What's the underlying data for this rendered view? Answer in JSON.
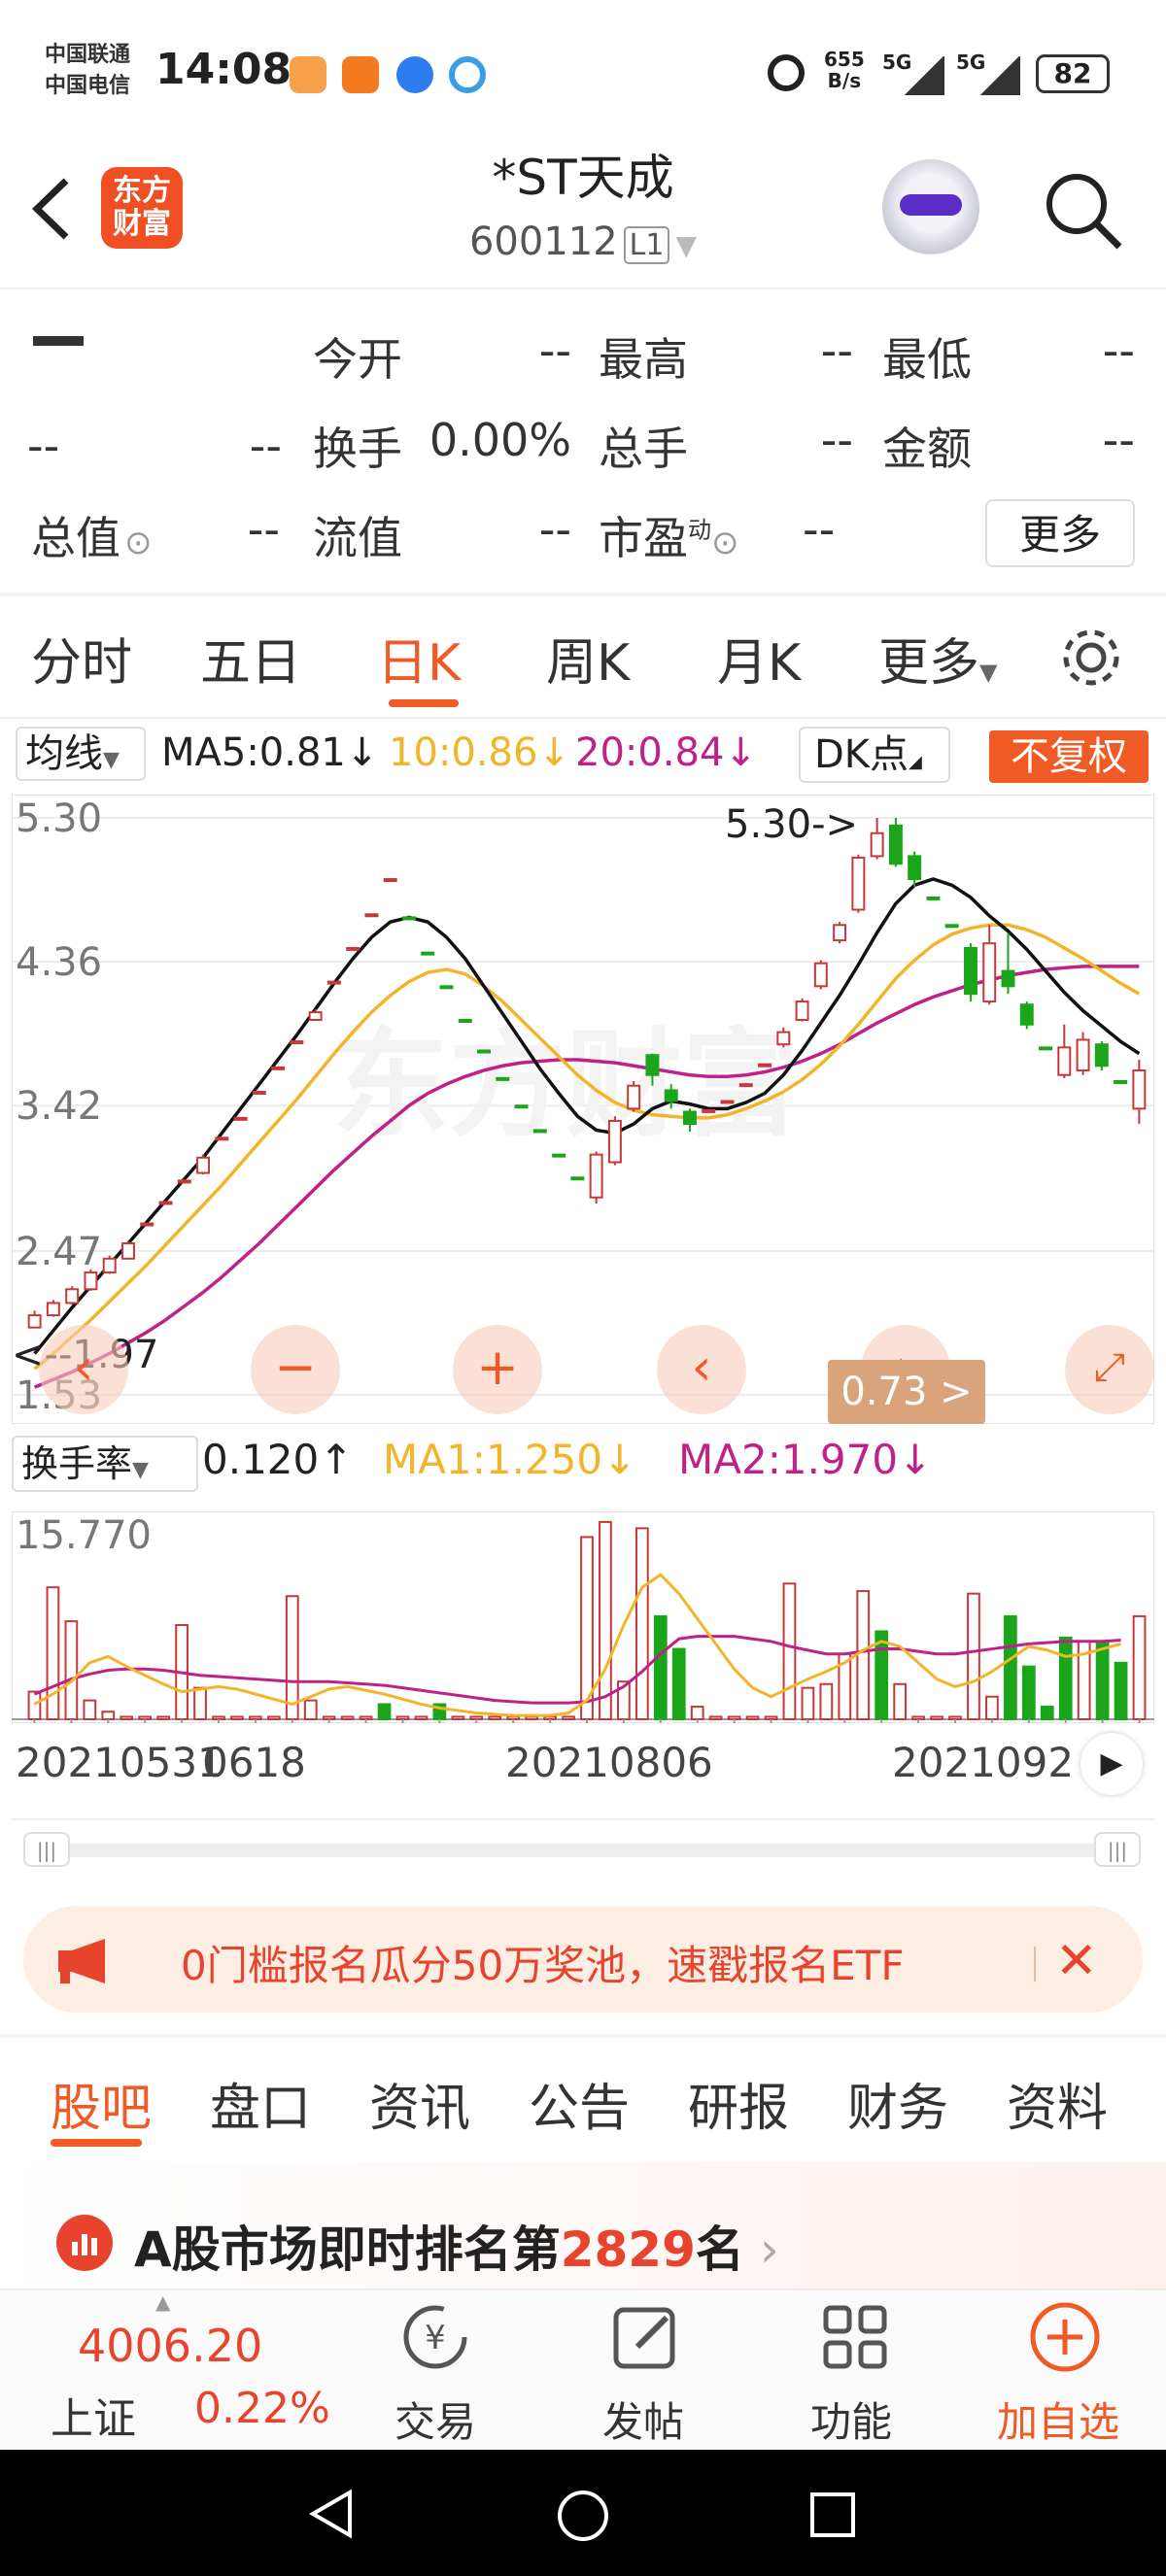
{
  "status_bar": {
    "carrier1": "中国联通",
    "carrier2": "中国电信",
    "time": "14:08",
    "net_speed_value": "655",
    "net_speed_unit": "B/s",
    "signal1": "5G",
    "signal2": "5G",
    "battery": "82"
  },
  "header": {
    "logo_text": "东方财富",
    "title": "*ST天成",
    "code": "600112",
    "level": "L1"
  },
  "quote": {
    "price": "--",
    "change": "--",
    "change_pct": "--",
    "open_label": "今开",
    "open_value": "--",
    "high_label": "最高",
    "high_value": "--",
    "low_label": "最低",
    "low_value": "--",
    "turnover_label": "换手",
    "turnover_value": "0.00%",
    "volume_label": "总手",
    "volume_value": "--",
    "amount_label": "金额",
    "amount_value": "--",
    "mktcap_label": "总值",
    "mktcap_value": "--",
    "float_label": "流值",
    "float_value": "--",
    "pe_label": "市盈",
    "pe_sup": "动",
    "pe_value": "--",
    "more_label": "更多"
  },
  "period_tabs": [
    "分时",
    "五日",
    "日K",
    "周K",
    "月K",
    "更多"
  ],
  "ma_bar": {
    "select": "均线",
    "ma5": "MA5:0.81",
    "ma10": "10:0.86",
    "ma20": "20:0.84",
    "dk": "DK点",
    "adjust": "不复权"
  },
  "chart_labels": {
    "high_marker": "5.30->",
    "low_marker": "<--1.97",
    "tooltip": "0.73 >"
  },
  "turnover_bar": {
    "select": "换手率",
    "value": "0.120",
    "ma1": "MA1:1.250",
    "ma2": "MA2:1.970",
    "max_label": "15.770"
  },
  "dates": [
    "20210531",
    "0618",
    "20210806",
    "2021092"
  ],
  "promo": {
    "text": "0门槛报名瓜分50万奖池，速戳报名ETF"
  },
  "bottom_tabs": [
    "股吧",
    "盘口",
    "资讯",
    "公告",
    "研报",
    "财务",
    "资料"
  ],
  "rank": {
    "prefix": "A股市场即时排名第",
    "number": "2829",
    "suffix": "名"
  },
  "bottom_bar": {
    "index_value": "4006.20",
    "index_name": "上证",
    "index_pct": "0.22%",
    "trade": "交易",
    "post": "发帖",
    "functions": "功能",
    "add_watch": "加自选"
  },
  "colors": {
    "accent": "#f05a24",
    "up": "#c8383a",
    "down": "#1aa51a",
    "ma5": "#111111",
    "ma10": "#f2b52a",
    "ma20": "#c0208a"
  },
  "chart_data": {
    "type": "candlestick",
    "y_ticks": [
      "5.30",
      "4.36",
      "3.42",
      "2.47",
      "1.53"
    ],
    "ylim": [
      1.53,
      5.3
    ],
    "candles": [
      {
        "o": 1.97,
        "c": 2.05,
        "h": 2.08,
        "l": 1.97
      },
      {
        "o": 2.05,
        "c": 2.13,
        "h": 2.15,
        "l": 2.04
      },
      {
        "o": 2.13,
        "c": 2.22,
        "h": 2.24,
        "l": 2.12
      },
      {
        "o": 2.22,
        "c": 2.33,
        "h": 2.35,
        "l": 2.21
      },
      {
        "o": 2.33,
        "c": 2.42,
        "h": 2.44,
        "l": 2.32
      },
      {
        "o": 2.42,
        "c": 2.52,
        "h": 2.53,
        "l": 2.52
      },
      {
        "o": 2.64,
        "c": 2.65,
        "h": 2.65,
        "l": 2.64
      },
      {
        "o": 2.78,
        "c": 2.79,
        "h": 2.79,
        "l": 2.78
      },
      {
        "o": 2.92,
        "c": 2.93,
        "h": 2.93,
        "l": 2.92
      },
      {
        "o": 2.98,
        "c": 3.08,
        "h": 3.1,
        "l": 2.97
      },
      {
        "o": 3.2,
        "c": 3.21,
        "h": 3.21,
        "l": 3.2
      },
      {
        "o": 3.33,
        "c": 3.34,
        "h": 3.34,
        "l": 3.33
      },
      {
        "o": 3.5,
        "c": 3.51,
        "h": 3.51,
        "l": 3.5
      },
      {
        "o": 3.66,
        "c": 3.67,
        "h": 3.67,
        "l": 3.66
      },
      {
        "o": 3.83,
        "c": 3.84,
        "h": 3.84,
        "l": 3.83
      },
      {
        "o": 3.98,
        "c": 4.03,
        "h": 4.05,
        "l": 3.98
      },
      {
        "o": 4.22,
        "c": 4.23,
        "h": 4.23,
        "l": 4.22
      },
      {
        "o": 4.44,
        "c": 4.45,
        "h": 4.45,
        "l": 4.44
      },
      {
        "o": 4.66,
        "c": 4.67,
        "h": 4.67,
        "l": 4.66
      },
      {
        "o": 4.89,
        "c": 4.9,
        "h": 4.9,
        "l": 4.89
      },
      {
        "o": 4.65,
        "c": 4.64,
        "h": 4.65,
        "l": 4.64
      },
      {
        "o": 4.42,
        "c": 4.41,
        "h": 4.42,
        "l": 4.41
      },
      {
        "o": 4.2,
        "c": 4.19,
        "h": 4.2,
        "l": 4.19
      },
      {
        "o": 3.98,
        "c": 3.97,
        "h": 3.98,
        "l": 3.97
      },
      {
        "o": 3.78,
        "c": 3.77,
        "h": 3.78,
        "l": 3.77
      },
      {
        "o": 3.6,
        "c": 3.59,
        "h": 3.6,
        "l": 3.59
      },
      {
        "o": 3.42,
        "c": 3.41,
        "h": 3.42,
        "l": 3.41
      },
      {
        "o": 3.26,
        "c": 3.25,
        "h": 3.26,
        "l": 3.25
      },
      {
        "o": 3.1,
        "c": 3.09,
        "h": 3.1,
        "l": 3.09
      },
      {
        "o": 2.95,
        "c": 2.94,
        "h": 2.95,
        "l": 2.94
      },
      {
        "o": 2.82,
        "c": 3.1,
        "h": 3.12,
        "l": 2.78
      },
      {
        "o": 3.05,
        "c": 3.32,
        "h": 3.35,
        "l": 3.03
      },
      {
        "o": 3.4,
        "c": 3.55,
        "h": 3.58,
        "l": 3.38
      },
      {
        "o": 3.75,
        "c": 3.62,
        "h": 3.76,
        "l": 3.55
      },
      {
        "o": 3.52,
        "c": 3.45,
        "h": 3.56,
        "l": 3.4
      },
      {
        "o": 3.38,
        "c": 3.3,
        "h": 3.4,
        "l": 3.25
      },
      {
        "o": 3.38,
        "c": 3.39,
        "h": 3.39,
        "l": 3.38
      },
      {
        "o": 3.44,
        "c": 3.45,
        "h": 3.45,
        "l": 3.44
      },
      {
        "o": 3.55,
        "c": 3.56,
        "h": 3.56,
        "l": 3.55
      },
      {
        "o": 3.68,
        "c": 3.69,
        "h": 3.69,
        "l": 3.68
      },
      {
        "o": 3.82,
        "c": 3.9,
        "h": 3.93,
        "l": 3.8
      },
      {
        "o": 3.98,
        "c": 4.1,
        "h": 4.12,
        "l": 3.97
      },
      {
        "o": 4.2,
        "c": 4.35,
        "h": 4.37,
        "l": 4.18
      },
      {
        "o": 4.5,
        "c": 4.6,
        "h": 4.62,
        "l": 4.48
      },
      {
        "o": 4.7,
        "c": 5.04,
        "h": 5.06,
        "l": 4.68
      },
      {
        "o": 5.05,
        "c": 5.2,
        "h": 5.3,
        "l": 5.03
      },
      {
        "o": 5.25,
        "c": 5.0,
        "h": 5.3,
        "l": 4.98
      },
      {
        "o": 5.05,
        "c": 4.9,
        "h": 5.08,
        "l": 4.85
      },
      {
        "o": 4.78,
        "c": 4.77,
        "h": 4.78,
        "l": 4.77
      },
      {
        "o": 4.6,
        "c": 4.59,
        "h": 4.6,
        "l": 4.59
      },
      {
        "o": 4.45,
        "c": 4.15,
        "h": 4.48,
        "l": 4.1
      },
      {
        "o": 4.1,
        "c": 4.48,
        "h": 4.6,
        "l": 4.08
      },
      {
        "o": 4.3,
        "c": 4.2,
        "h": 4.55,
        "l": 4.15
      },
      {
        "o": 4.08,
        "c": 3.95,
        "h": 4.1,
        "l": 3.92
      },
      {
        "o": 3.8,
        "c": 3.79,
        "h": 3.8,
        "l": 3.79
      },
      {
        "o": 3.62,
        "c": 3.8,
        "h": 3.95,
        "l": 3.6
      },
      {
        "o": 3.65,
        "c": 3.85,
        "h": 3.9,
        "l": 3.62
      },
      {
        "o": 3.82,
        "c": 3.68,
        "h": 3.84,
        "l": 3.65
      },
      {
        "o": 3.58,
        "c": 3.57,
        "h": 3.58,
        "l": 3.57
      },
      {
        "o": 3.4,
        "c": 3.65,
        "h": 3.72,
        "l": 3.3
      }
    ],
    "ma5": [
      1.8,
      1.95,
      2.1,
      2.24,
      2.38,
      2.52,
      2.66,
      2.8,
      2.94,
      3.08,
      3.24,
      3.4,
      3.56,
      3.72,
      3.88,
      4.05,
      4.22,
      4.38,
      4.52,
      4.62,
      4.65,
      4.62,
      4.52,
      4.38,
      4.2,
      4.02,
      3.84,
      3.66,
      3.5,
      3.35,
      3.26,
      3.24,
      3.3,
      3.4,
      3.45,
      3.43,
      3.4,
      3.4,
      3.44,
      3.5,
      3.62,
      3.78,
      3.96,
      4.14,
      4.34,
      4.55,
      4.74,
      4.86,
      4.9,
      4.86,
      4.78,
      4.66,
      4.56,
      4.44,
      4.3,
      4.16,
      4.04,
      3.94,
      3.84,
      3.76
    ],
    "ma10": [
      1.7,
      1.8,
      1.91,
      2.02,
      2.14,
      2.26,
      2.38,
      2.51,
      2.64,
      2.77,
      2.9,
      3.04,
      3.18,
      3.32,
      3.46,
      3.61,
      3.76,
      3.9,
      4.03,
      4.14,
      4.23,
      4.29,
      4.31,
      4.28,
      4.2,
      4.1,
      3.98,
      3.86,
      3.74,
      3.62,
      3.52,
      3.44,
      3.39,
      3.36,
      3.35,
      3.34,
      3.34,
      3.36,
      3.4,
      3.45,
      3.51,
      3.59,
      3.69,
      3.81,
      3.95,
      4.1,
      4.25,
      4.37,
      4.47,
      4.54,
      4.58,
      4.6,
      4.6,
      4.57,
      4.52,
      4.45,
      4.38,
      4.3,
      4.22,
      4.15
    ],
    "ma20": [
      1.58,
      1.63,
      1.68,
      1.74,
      1.8,
      1.87,
      1.94,
      2.02,
      2.11,
      2.2,
      2.3,
      2.41,
      2.52,
      2.64,
      2.76,
      2.88,
      3.0,
      3.11,
      3.22,
      3.32,
      3.42,
      3.5,
      3.56,
      3.61,
      3.65,
      3.68,
      3.7,
      3.71,
      3.72,
      3.72,
      3.71,
      3.7,
      3.68,
      3.66,
      3.64,
      3.62,
      3.61,
      3.61,
      3.62,
      3.64,
      3.67,
      3.71,
      3.76,
      3.82,
      3.89,
      3.96,
      4.02,
      4.08,
      4.13,
      4.17,
      4.21,
      4.24,
      4.27,
      4.29,
      4.31,
      4.32,
      4.33,
      4.33,
      4.33,
      4.33
    ]
  },
  "turnover_data": {
    "max": 15.77,
    "bars": [
      {
        "v": 2.2,
        "up": true
      },
      {
        "v": 10.5,
        "up": true
      },
      {
        "v": 7.8,
        "up": true
      },
      {
        "v": 1.5,
        "up": true
      },
      {
        "v": 0.6,
        "up": true
      },
      {
        "v": 0.2,
        "up": true
      },
      {
        "v": 0.2,
        "up": true
      },
      {
        "v": 0.2,
        "up": true
      },
      {
        "v": 7.5,
        "up": true
      },
      {
        "v": 2.5,
        "up": true
      },
      {
        "v": 0.2,
        "up": true
      },
      {
        "v": 0.2,
        "up": true
      },
      {
        "v": 0.2,
        "up": true
      },
      {
        "v": 0.2,
        "up": true
      },
      {
        "v": 9.8,
        "up": true
      },
      {
        "v": 1.5,
        "up": true
      },
      {
        "v": 0.2,
        "up": true
      },
      {
        "v": 0.2,
        "up": true
      },
      {
        "v": 0.2,
        "up": true
      },
      {
        "v": 1.2,
        "up": false
      },
      {
        "v": 0.2,
        "up": true
      },
      {
        "v": 0.2,
        "up": true
      },
      {
        "v": 1.2,
        "up": false
      },
      {
        "v": 0.2,
        "up": true
      },
      {
        "v": 0.2,
        "up": true
      },
      {
        "v": 0.2,
        "up": true
      },
      {
        "v": 0.2,
        "up": true
      },
      {
        "v": 0.2,
        "up": true
      },
      {
        "v": 0.2,
        "up": true
      },
      {
        "v": 0.2,
        "up": true
      },
      {
        "v": 14.5,
        "up": true
      },
      {
        "v": 15.7,
        "up": true
      },
      {
        "v": 3.0,
        "up": true
      },
      {
        "v": 15.2,
        "up": true
      },
      {
        "v": 8.2,
        "up": false
      },
      {
        "v": 5.6,
        "up": false
      },
      {
        "v": 1.0,
        "up": true
      },
      {
        "v": 0.2,
        "up": true
      },
      {
        "v": 0.2,
        "up": true
      },
      {
        "v": 0.2,
        "up": true
      },
      {
        "v": 0.2,
        "up": true
      },
      {
        "v": 10.8,
        "up": true
      },
      {
        "v": 2.5,
        "up": true
      },
      {
        "v": 2.8,
        "up": true
      },
      {
        "v": 5.2,
        "up": true
      },
      {
        "v": 10.2,
        "up": true
      },
      {
        "v": 7.0,
        "up": false
      },
      {
        "v": 2.8,
        "up": true
      },
      {
        "v": 0.2,
        "up": true
      },
      {
        "v": 0.2,
        "up": true
      },
      {
        "v": 0.2,
        "up": true
      },
      {
        "v": 10.0,
        "up": true
      },
      {
        "v": 1.8,
        "up": true
      },
      {
        "v": 8.2,
        "up": false
      },
      {
        "v": 4.2,
        "up": false
      },
      {
        "v": 1.0,
        "up": false
      },
      {
        "v": 6.5,
        "up": false
      },
      {
        "v": 6.2,
        "up": true
      },
      {
        "v": 6.2,
        "up": false
      },
      {
        "v": 4.5,
        "up": false
      },
      {
        "v": 8.2,
        "up": true
      }
    ],
    "ma1": [
      1.2,
      2.0,
      3.0,
      4.5,
      5.0,
      4.2,
      3.5,
      2.8,
      2.2,
      2.4,
      2.6,
      2.4,
      2.0,
      1.6,
      1.2,
      1.8,
      2.4,
      2.6,
      2.3,
      2.0,
      1.6,
      1.2,
      0.9,
      0.7,
      0.5,
      0.4,
      0.3,
      0.3,
      0.3,
      0.5,
      1.5,
      4.0,
      7.5,
      10.5,
      11.5,
      10.0,
      8.0,
      6.0,
      4.0,
      2.5,
      1.8,
      2.5,
      3.2,
      3.8,
      4.5,
      5.5,
      6.2,
      5.8,
      4.5,
      3.2,
      2.6,
      3.0,
      3.8,
      4.8,
      5.8,
      5.5,
      5.0,
      5.2,
      5.6,
      6.0
    ],
    "ma2": [
      2.0,
      2.6,
      3.2,
      3.6,
      3.9,
      4.0,
      4.0,
      3.9,
      3.7,
      3.5,
      3.4,
      3.3,
      3.2,
      3.1,
      3.0,
      3.0,
      3.0,
      2.9,
      2.8,
      2.7,
      2.5,
      2.3,
      2.1,
      1.9,
      1.7,
      1.5,
      1.4,
      1.3,
      1.3,
      1.3,
      1.4,
      1.8,
      2.6,
      3.8,
      5.2,
      6.4,
      6.6,
      6.6,
      6.6,
      6.4,
      6.2,
      5.8,
      5.5,
      5.2,
      5.2,
      5.4,
      5.6,
      5.6,
      5.4,
      5.2,
      5.2,
      5.4,
      5.6,
      5.8,
      6.0,
      6.1,
      6.2,
      6.2,
      6.2,
      6.3
    ]
  }
}
